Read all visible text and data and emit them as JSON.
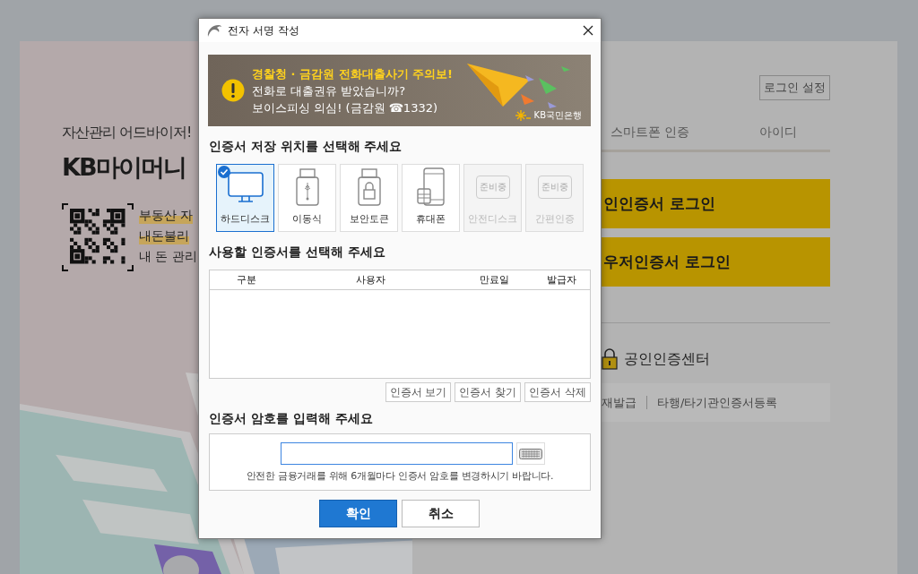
{
  "background": {
    "promo": {
      "subtitle": "자산관리 어드바이저!",
      "title": "KB마이머니",
      "lines": [
        {
          "text": "부동산 자",
          "highlighted": true
        },
        {
          "text": "내돈불리",
          "highlighted": true
        },
        {
          "text": "내 돈 관리",
          "highlighted": false
        }
      ]
    },
    "settings_button": "로그인 설정",
    "tabs": [
      {
        "label": "스마트폰 인증",
        "selected": false
      },
      {
        "label": "아이디",
        "selected": false
      }
    ],
    "login_buttons": [
      "인인증서 로그인",
      "우저인증서 로그인"
    ],
    "cert_center": "공인인증센터",
    "links": [
      "재발급",
      "타행/타기관인증서등록"
    ]
  },
  "dialog": {
    "title": "전자 서명 작성",
    "banner": {
      "headline": "경찰청 · 금감원 전화대출사기 주의보!",
      "lines": [
        "전화로 대출권유 받았습니까?",
        "보이스피싱 의심! (금감원 ☎1332)"
      ],
      "brand": "KB국민은행"
    },
    "location_heading": "인증서 저장 위치를 선택해 주세요",
    "locations": [
      {
        "label": "하드디스크",
        "kind": "monitor",
        "selected": true,
        "disabled": false
      },
      {
        "label": "이동식",
        "kind": "usb",
        "selected": false,
        "disabled": false
      },
      {
        "label": "보안토큰",
        "kind": "token",
        "selected": false,
        "disabled": false
      },
      {
        "label": "휴대폰",
        "kind": "phone",
        "selected": false,
        "disabled": false
      },
      {
        "label": "안전디스크",
        "kind": "safe",
        "selected": false,
        "disabled": true,
        "badge": "준비중"
      },
      {
        "label": "간편인증",
        "kind": "simple",
        "selected": false,
        "disabled": true,
        "badge": "준비중"
      }
    ],
    "cert_heading": "사용할 인증서를 선택해 주세요",
    "table": {
      "columns": [
        "구분",
        "사용자",
        "만료일",
        "발급자"
      ]
    },
    "cert_buttons": [
      "인증서 보기",
      "인증서 찾기",
      "인증서 삭제"
    ],
    "password_heading": "인증서 암호를 입력해 주세요",
    "password_notice": "안전한 금융거래를 위해 6개월마다 인증서 암호를 변경하시기 바랍니다.",
    "buttons": [
      {
        "label": "확인",
        "kind": "primary"
      },
      {
        "label": "취소",
        "kind": "secondary"
      }
    ]
  }
}
